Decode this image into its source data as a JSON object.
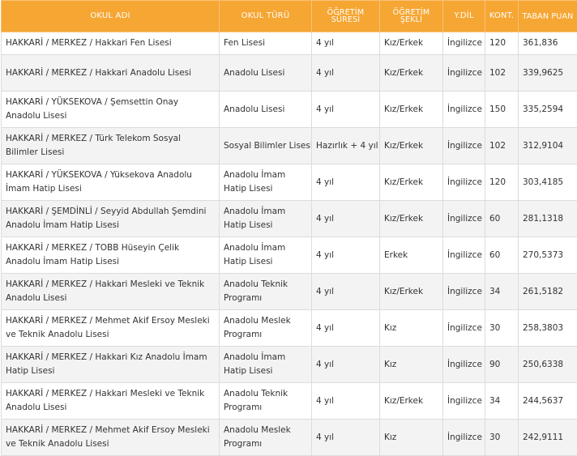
{
  "headers": {
    "okul_adi": "OKUL ADI",
    "okul_turu": "OKUL TÜRÜ",
    "ogretim_suresi": "ÖĞRETİM SÜRESİ",
    "ogretim_sekli": "ÖĞRETİM ŞEKLİ",
    "ydil": "Y.DİL",
    "kont": "KONT.",
    "taban_puan": "TABAN PUAN"
  },
  "colors": {
    "header_bg": "#f6a633",
    "header_text": "#ffffff",
    "row_alt": "#f3f3f3",
    "border": "#dcdcdc"
  },
  "rows": [
    {
      "okul_adi": "HAKKARİ / MERKEZ / Hakkari Fen Lisesi",
      "okul_turu": "Fen Lisesi",
      "sure": "4 yıl",
      "sekil": "Kız/Erkek",
      "dil": "İngilizce",
      "kont": "120",
      "puan": "361,836"
    },
    {
      "okul_adi": "HAKKARİ / MERKEZ / Hakkari Anadolu Lisesi",
      "okul_turu": "Anadolu Lisesi",
      "sure": "4 yıl",
      "sekil": "Kız/Erkek",
      "dil": "İngilizce",
      "kont": "102",
      "puan": "339,9625"
    },
    {
      "okul_adi": "HAKKARİ / YÜKSEKOVA / Şemsettin Onay Anadolu Lisesi",
      "okul_turu": "Anadolu Lisesi",
      "sure": "4 yıl",
      "sekil": "Kız/Erkek",
      "dil": "İngilizce",
      "kont": "150",
      "puan": "335,2594"
    },
    {
      "okul_adi": "HAKKARİ / MERKEZ / Türk Telekom Sosyal Bilimler Lisesi",
      "okul_turu": "Sosyal Bilimler Lisesi",
      "sure": "Hazırlık + 4 yıl",
      "sekil": "Kız/Erkek",
      "dil": "İngilizce",
      "kont": "102",
      "puan": "312,9104"
    },
    {
      "okul_adi": "HAKKARİ / YÜKSEKOVA / Yüksekova Anadolu İmam Hatip Lisesi",
      "okul_turu": "Anadolu İmam Hatip Lisesi",
      "sure": "4 yıl",
      "sekil": "Kız/Erkek",
      "dil": "İngilizce",
      "kont": "120",
      "puan": "303,4185"
    },
    {
      "okul_adi": "HAKKARİ / ŞEMDİNLİ / Seyyid Abdullah Şemdini Anadolu İmam Hatip Lisesi",
      "okul_turu": "Anadolu İmam Hatip Lisesi",
      "sure": "4 yıl",
      "sekil": "Kız/Erkek",
      "dil": "İngilizce",
      "kont": "60",
      "puan": "281,1318"
    },
    {
      "okul_adi": "HAKKARİ / MERKEZ / TOBB Hüseyin Çelik Anadolu İmam Hatip Lisesi",
      "okul_turu": "Anadolu İmam Hatip Lisesi",
      "sure": "4 yıl",
      "sekil": "Erkek",
      "dil": "İngilizce",
      "kont": "60",
      "puan": "270,5373"
    },
    {
      "okul_adi": "HAKKARİ / MERKEZ / Hakkari Mesleki ve Teknik Anadolu Lisesi",
      "okul_turu": "Anadolu Teknik Programı",
      "sure": "4 yıl",
      "sekil": "Kız/Erkek",
      "dil": "İngilizce",
      "kont": "34",
      "puan": "261,5182"
    },
    {
      "okul_adi": "HAKKARİ / MERKEZ / Mehmet Akif Ersoy Mesleki ve Teknik Anadolu Lisesi",
      "okul_turu": "Anadolu Meslek Programı",
      "sure": "4 yıl",
      "sekil": "Kız",
      "dil": "İngilizce",
      "kont": "30",
      "puan": "258,3803"
    },
    {
      "okul_adi": "HAKKARİ / MERKEZ / Hakkari Kız Anadolu İmam Hatip Lisesi",
      "okul_turu": "Anadolu İmam Hatip Lisesi",
      "sure": "4 yıl",
      "sekil": "Kız",
      "dil": "İngilizce",
      "kont": "90",
      "puan": "250,6338"
    },
    {
      "okul_adi": "HAKKARİ / MERKEZ / Hakkari Mesleki ve Teknik Anadolu Lisesi",
      "okul_turu": "Anadolu Teknik Programı",
      "sure": "4 yıl",
      "sekil": "Kız/Erkek",
      "dil": "İngilizce",
      "kont": "34",
      "puan": "244,5637"
    },
    {
      "okul_adi": "HAKKARİ / MERKEZ / Mehmet Akif Ersoy Mesleki ve Teknik Anadolu Lisesi",
      "okul_turu": "Anadolu Meslek Programı",
      "sure": "4 yıl",
      "sekil": "Kız",
      "dil": "İngilizce",
      "kont": "30",
      "puan": "242,9111"
    }
  ]
}
